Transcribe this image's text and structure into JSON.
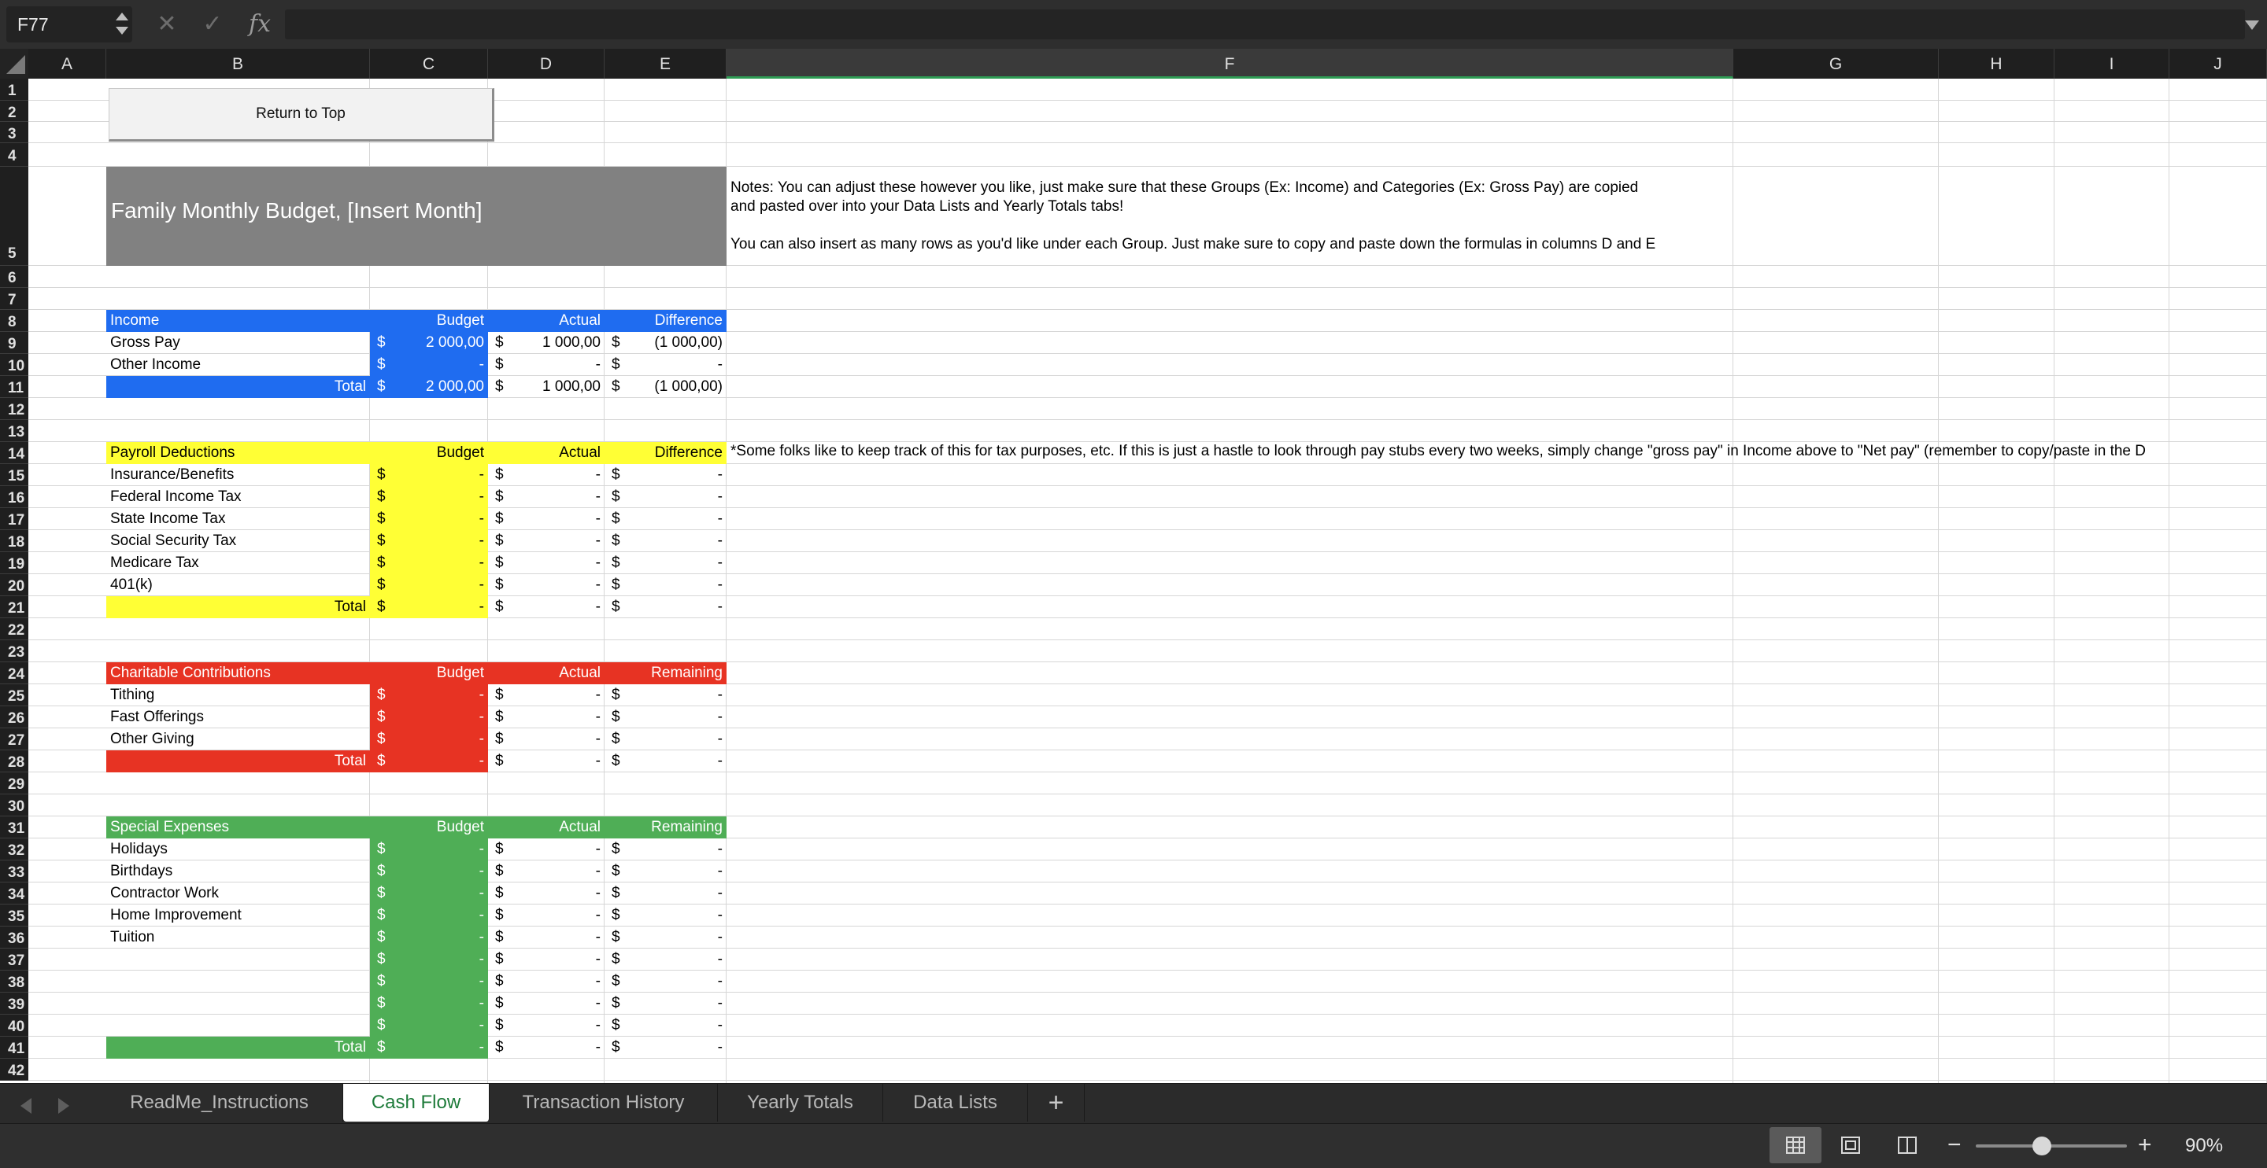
{
  "formula_bar": {
    "name_box": "F77",
    "formula": ""
  },
  "columns": [
    "A",
    "B",
    "C",
    "D",
    "E",
    "F",
    "G",
    "H",
    "I",
    "J"
  ],
  "selected_column": "F",
  "rows": [
    1,
    2,
    3,
    4,
    5,
    6,
    7,
    8,
    9,
    10,
    11,
    12,
    13,
    14,
    15,
    16,
    17,
    18,
    19,
    20,
    21,
    22,
    23,
    24,
    25,
    26,
    27,
    28,
    29,
    30,
    31,
    32,
    33,
    34,
    35,
    36,
    37,
    38,
    39,
    40,
    41,
    42
  ],
  "return_button": "Return to Top",
  "title": "Family Monthly Budget, [Insert Month]",
  "notes": {
    "line1": "Notes: You can adjust these however you like, just make sure that these Groups (Ex: Income) and Categories (Ex: Gross Pay) are copied",
    "line2": "and pasted over into your Data Lists and Yearly Totals tabs!",
    "line3": "You can also insert as many rows as you'd like under each Group. Just make sure to copy and paste down the formulas in columns D and E",
    "payroll_note": "*Some folks like to keep track of this for tax purposes, etc. If this is just a hastle to look through pay stubs every two weeks, simply change \"gross pay\" in Income above to \"Net pay\" (remember to copy/paste in the D"
  },
  "sections": [
    {
      "name": "Income",
      "color": "#1f6cf0",
      "headers": [
        "Budget",
        "Actual",
        "Difference"
      ],
      "rows": [
        {
          "label": "Gross Pay",
          "budget": "2 000,00",
          "actual": "1 000,00",
          "diff": "(1 000,00)"
        },
        {
          "label": "Other Income",
          "budget": "-",
          "actual": "-",
          "diff": "-"
        }
      ],
      "total": {
        "label": "Total",
        "budget": "2 000,00",
        "actual": "1 000,00",
        "diff": "(1 000,00)"
      }
    },
    {
      "name": "Payroll Deductions",
      "color": "#ffff35",
      "headers": [
        "Budget",
        "Actual",
        "Difference"
      ],
      "rows": [
        {
          "label": "Insurance/Benefits",
          "budget": "-",
          "actual": "-",
          "diff": "-"
        },
        {
          "label": "Federal Income Tax",
          "budget": "-",
          "actual": "-",
          "diff": "-"
        },
        {
          "label": "State Income Tax",
          "budget": "-",
          "actual": "-",
          "diff": "-"
        },
        {
          "label": "Social Security Tax",
          "budget": "-",
          "actual": "-",
          "diff": "-"
        },
        {
          "label": "Medicare Tax",
          "budget": "-",
          "actual": "-",
          "diff": "-"
        },
        {
          "label": "401(k)",
          "budget": "-",
          "actual": "-",
          "diff": "-"
        }
      ],
      "total": {
        "label": "Total",
        "budget": "-",
        "actual": "-",
        "diff": "-"
      }
    },
    {
      "name": "Charitable Contributions",
      "color": "#e73323",
      "headers": [
        "Budget",
        "Actual",
        "Remaining"
      ],
      "rows": [
        {
          "label": "Tithing",
          "budget": "-",
          "actual": "-",
          "diff": "-"
        },
        {
          "label": "Fast Offerings",
          "budget": "-",
          "actual": "-",
          "diff": "-"
        },
        {
          "label": "Other Giving",
          "budget": "-",
          "actual": "-",
          "diff": "-"
        }
      ],
      "total": {
        "label": "Total",
        "budget": "-",
        "actual": "-",
        "diff": "-"
      }
    },
    {
      "name": "Special Expenses",
      "color": "#4fae56",
      "headers": [
        "Budget",
        "Actual",
        "Remaining"
      ],
      "rows": [
        {
          "label": "Holidays",
          "budget": "-",
          "actual": "-",
          "diff": "-"
        },
        {
          "label": "Birthdays",
          "budget": "-",
          "actual": "-",
          "diff": "-"
        },
        {
          "label": "Contractor Work",
          "budget": "-",
          "actual": "-",
          "diff": "-"
        },
        {
          "label": "Home Improvement",
          "budget": "-",
          "actual": "-",
          "diff": "-"
        },
        {
          "label": "Tuition",
          "budget": "-",
          "actual": "-",
          "diff": "-"
        },
        {
          "label": "",
          "budget": "-",
          "actual": "-",
          "diff": "-"
        },
        {
          "label": "",
          "budget": "-",
          "actual": "-",
          "diff": "-"
        },
        {
          "label": "",
          "budget": "-",
          "actual": "-",
          "diff": "-"
        },
        {
          "label": "",
          "budget": "-",
          "actual": "-",
          "diff": "-"
        }
      ],
      "total": {
        "label": "Total",
        "budget": "-",
        "actual": "-",
        "diff": "-"
      }
    }
  ],
  "currency": "$",
  "sheet_tabs": [
    {
      "label": "ReadMe_Instructions",
      "active": false
    },
    {
      "label": "Cash Flow",
      "active": true
    },
    {
      "label": "Transaction History",
      "active": false
    },
    {
      "label": "Yearly Totals",
      "active": false
    },
    {
      "label": "Data Lists",
      "active": false
    }
  ],
  "zoom": "90%"
}
